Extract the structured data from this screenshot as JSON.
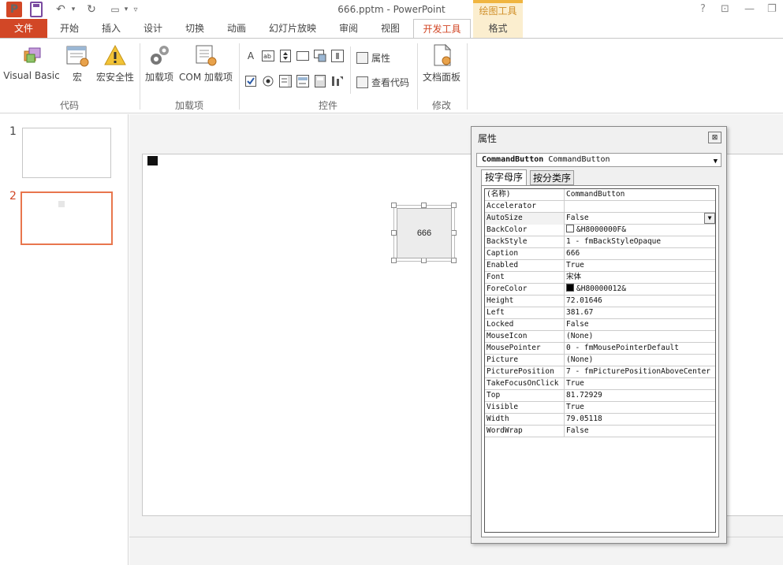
{
  "window": {
    "title": "666.pptm - PowerPoint",
    "app_logo": "P",
    "contextual_group": "绘图工具",
    "controls": [
      "?",
      "⊡",
      "—",
      "❐"
    ]
  },
  "tabs": [
    {
      "label": "文件"
    },
    {
      "label": "开始"
    },
    {
      "label": "插入"
    },
    {
      "label": "设计"
    },
    {
      "label": "切换"
    },
    {
      "label": "动画"
    },
    {
      "label": "幻灯片放映"
    },
    {
      "label": "审阅"
    },
    {
      "label": "视图"
    },
    {
      "label": "开发工具"
    },
    {
      "label": "格式"
    }
  ],
  "ribbon": {
    "code_group": {
      "label": "代码",
      "visual_basic": "Visual Basic",
      "macros": "宏",
      "macro_security": "宏安全性"
    },
    "addins_group": {
      "label": "加载项",
      "addins": "加载项",
      "com_addins": "COM 加载项"
    },
    "controls_group": {
      "label": "控件",
      "properties": "属性",
      "view_code": "查看代码"
    },
    "modify_group": {
      "label": "修改",
      "document_panel": "文档面板"
    }
  },
  "thumbnails": [
    {
      "number": "1"
    },
    {
      "number": "2"
    }
  ],
  "slide": {
    "command_button_caption": "666"
  },
  "properties_window": {
    "title": "属性",
    "close_glyph": "⊠",
    "object_name": "CommandButton",
    "object_type": "CommandButton",
    "tab_alphabetic": "按字母序",
    "tab_categorized": "按分类序",
    "rows": [
      {
        "name": "(名称)",
        "value": "CommandButton"
      },
      {
        "name": "Accelerator",
        "value": ""
      },
      {
        "name": "AutoSize",
        "value": "False"
      },
      {
        "name": "BackColor",
        "value": "&H8000000F&",
        "swatch": "#ffffff"
      },
      {
        "name": "BackStyle",
        "value": "1 - fmBackStyleOpaque"
      },
      {
        "name": "Caption",
        "value": "666"
      },
      {
        "name": "Enabled",
        "value": "True"
      },
      {
        "name": "Font",
        "value": "宋体"
      },
      {
        "name": "ForeColor",
        "value": "&H80000012&",
        "swatch": "#000000"
      },
      {
        "name": "Height",
        "value": "72.01646"
      },
      {
        "name": "Left",
        "value": "381.67"
      },
      {
        "name": "Locked",
        "value": "False"
      },
      {
        "name": "MouseIcon",
        "value": "(None)"
      },
      {
        "name": "MousePointer",
        "value": "0 - fmMousePointerDefault"
      },
      {
        "name": "Picture",
        "value": "(None)"
      },
      {
        "name": "PicturePosition",
        "value": "7 - fmPicturePositionAboveCenter"
      },
      {
        "name": "TakeFocusOnClick",
        "value": "True"
      },
      {
        "name": "Top",
        "value": "81.72929"
      },
      {
        "name": "Visible",
        "value": "True"
      },
      {
        "name": "Width",
        "value": "79.05118"
      },
      {
        "name": "WordWrap",
        "value": "False"
      }
    ]
  },
  "colors": {
    "accent": "#d24726",
    "contextual": "#f0b540",
    "thumb_selected": "#e8764d"
  }
}
